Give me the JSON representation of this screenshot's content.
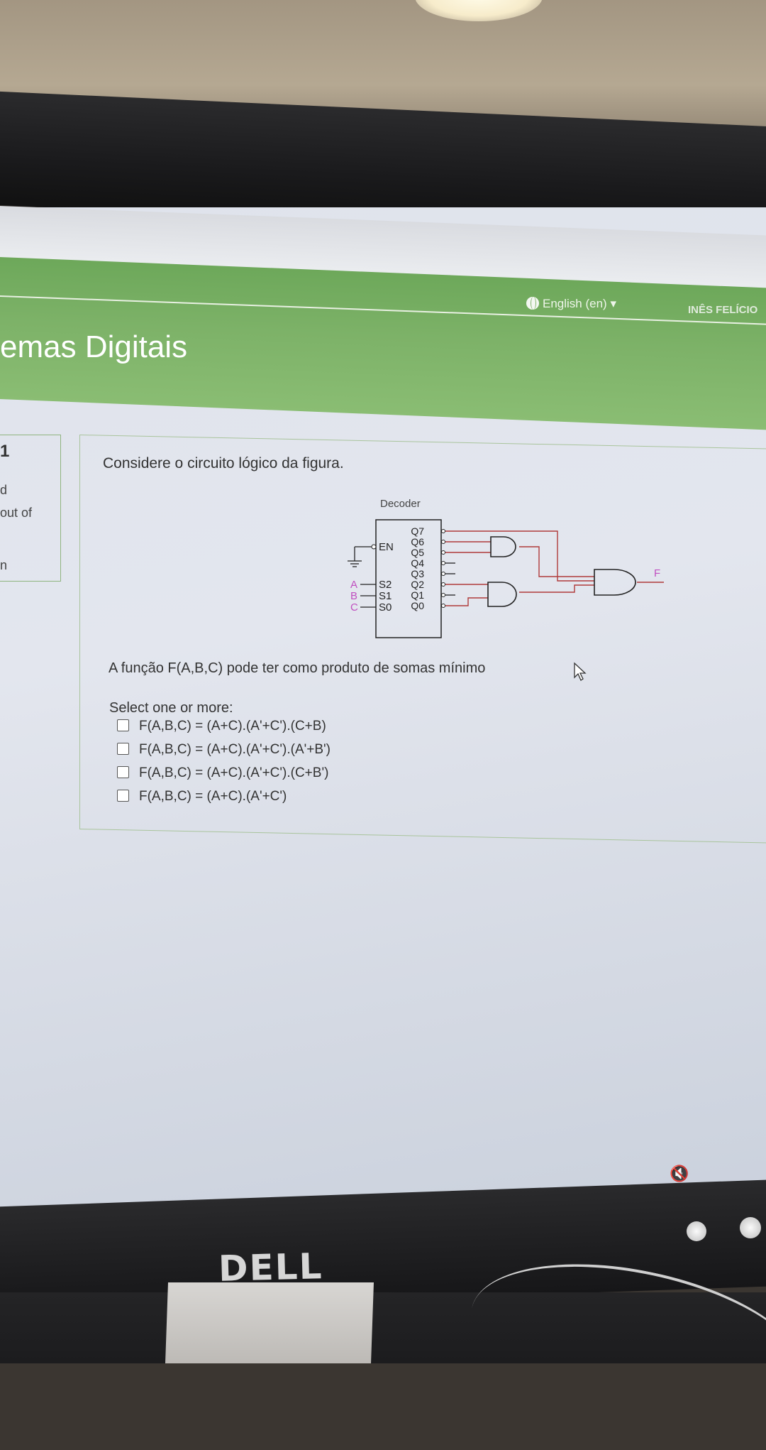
{
  "header": {
    "site_title": "emas Digitais",
    "language": "English (en)",
    "user_name": "INÊS FELÍCIO"
  },
  "question_info": {
    "number": "1",
    "state": "d",
    "marks": "out of",
    "flag": "n"
  },
  "question": {
    "text": "Considere o circuito lógico da figura.",
    "prompt": "A função F(A,B,C) pode ter como produto de somas mínimo",
    "select_label": "Select one or more:",
    "options": [
      "F(A,B,C) = (A+C).(A'+C').(C+B)",
      "F(A,B,C) = (A+C).(A'+C').(A'+B')",
      "F(A,B,C) = (A+C).(A'+C').(C+B')",
      "F(A,B,C) = (A+C).(A'+C')"
    ]
  },
  "circuit": {
    "title": "Decoder",
    "enable_label": "EN",
    "select_labels": [
      "S2",
      "S1",
      "S0"
    ],
    "input_labels": [
      "A",
      "B",
      "C"
    ],
    "output_labels": [
      "Q7",
      "Q6",
      "Q5",
      "Q4",
      "Q3",
      "Q2",
      "Q1",
      "Q0"
    ],
    "output_name": "F",
    "wire_color": "#b03a3a",
    "label_accent": "#c04fc0"
  },
  "brand": {
    "logo_text": "DELL"
  },
  "icons": {
    "globe": "globe-icon",
    "mute": "speaker-mute-icon",
    "cursor": "mouse-pointer-icon"
  }
}
